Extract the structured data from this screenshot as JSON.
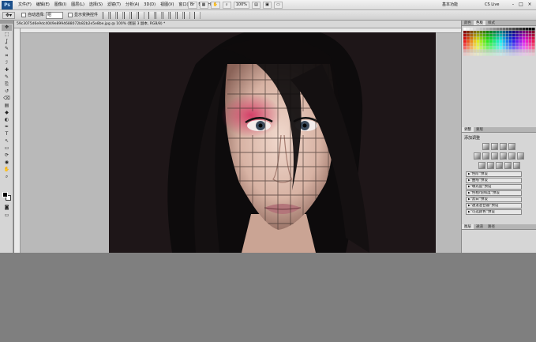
{
  "app": {
    "logo": "Ps"
  },
  "menubar": {
    "items": [
      "文件(F)",
      "编辑(E)",
      "图像(I)",
      "图层(L)",
      "选择(S)",
      "滤镜(T)",
      "分析(A)",
      "3D(D)",
      "视图(V)",
      "窗口(W)",
      "帮助(H)"
    ],
    "zoom": "100%",
    "workspace": "基本功能",
    "cslive": "CS Live",
    "controls": [
      "-",
      "□",
      "×"
    ]
  },
  "options_bar": {
    "auto_select_label": "自动选择:",
    "auto_select_value": "组",
    "show_transform_label": "显示变换控件"
  },
  "document": {
    "tab_title": "59c3075d6e9dc4049e8994688072b82b2e5e8be.jpg @ 100% (图层 3 副本, RGB/8) *"
  },
  "tools": [
    "move-tool",
    "marquee-tool",
    "lasso-tool",
    "quick-select-tool",
    "crop-tool",
    "eyedropper-tool",
    "healing-tool",
    "brush-tool",
    "clone-tool",
    "history-brush-tool",
    "eraser-tool",
    "gradient-tool",
    "blur-tool",
    "dodge-tool",
    "pen-tool",
    "type-tool",
    "path-select-tool",
    "shape-tool",
    "3d-rotate-tool",
    "3d-camera-tool",
    "hand-tool",
    "zoom-tool"
  ],
  "tool_glyphs": [
    "✥",
    "⬚",
    "ʆ",
    "✎",
    "⌗",
    "ℐ",
    "✚",
    "✎",
    "⎘",
    "↺",
    "⌫",
    "▤",
    "◆",
    "◐",
    "✒",
    "T",
    "↖",
    "▭",
    "⟳",
    "◉",
    "✋",
    "⌕"
  ],
  "dock": {
    "swatch_tabs": [
      "颜色",
      "色板",
      "样式"
    ],
    "adjust_tabs": [
      "调整",
      "蒙版"
    ],
    "adjust_title": "添加调整",
    "presets": [
      "\"色阶\"预设",
      "\"曲线\"预设",
      "\"曝光度\"预设",
      "\"色相/饱和度\"预设",
      "\"黑白\"预设",
      "\"通道混合器\"预设",
      "\"可选颜色\"预设"
    ],
    "layers_tabs": [
      "图层",
      "通道",
      "路径"
    ]
  },
  "colors": {
    "workspace_gray": "#b9b9b9",
    "panel_gray": "#d6d6d6",
    "canvas_bg": "#1e1618"
  }
}
